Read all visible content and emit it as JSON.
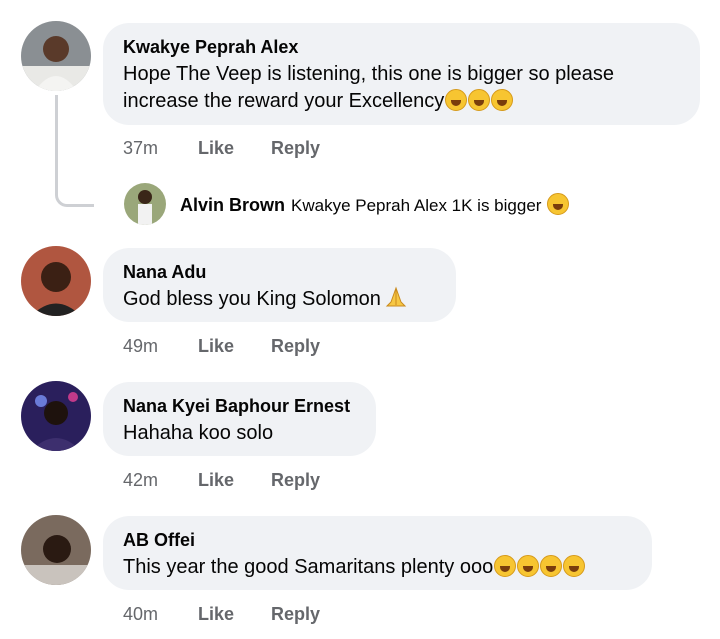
{
  "comments": [
    {
      "name": "Kwakye Peprah Alex",
      "text_line1": "Hope The Veep is listening, this one is bigger so please",
      "text_line2": "increase the reward your Excellency",
      "time": "37m",
      "like": "Like",
      "reply": "Reply",
      "emoji": "rolling-laughing-emoji"
    },
    {
      "name": "Nana Adu",
      "text": "God bless you King Solomon",
      "time": "49m",
      "like": "Like",
      "reply": "Reply",
      "emoji": "folded-hands-emoji"
    },
    {
      "name": "Nana Kyei Baphour Ernest",
      "text": "Hahaha koo solo",
      "time": "42m",
      "like": "Like",
      "reply": "Reply"
    },
    {
      "name": "AB Offei",
      "text": "This year the good Samaritans plenty ooo",
      "time": "40m",
      "like": "Like",
      "reply": "Reply",
      "emoji": "grinning-squinting-emoji"
    }
  ],
  "reply": {
    "name": "Alvin Brown",
    "text": "Kwakye Peprah Alex 1K is bigger"
  },
  "colors": {
    "bubble": "#f0f2f5",
    "meta": "#65676b",
    "thread_line": "#ced0d4"
  }
}
